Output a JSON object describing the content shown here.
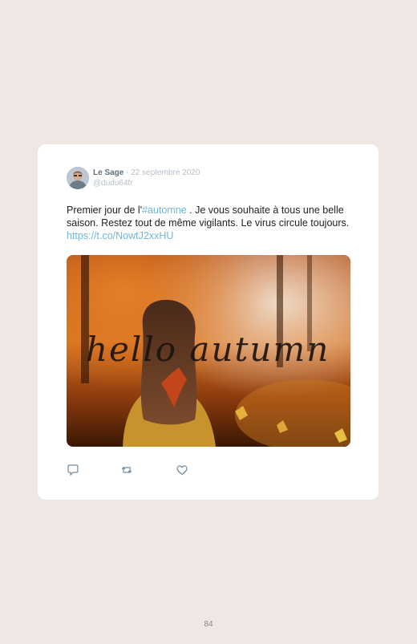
{
  "tweet": {
    "author": "Le Sage",
    "separator": " · ",
    "date": "22 septembre 2020",
    "handle": "@dudu64fr",
    "text_before": "Premier jour de l'",
    "hashtag": "#automne",
    "text_after": " . Je vous souhaite à tous une belle saison. Restez tout de même vigilants. Le virus circule toujours. ",
    "link": "https://t.co/NowtJ2xxHU",
    "image_overlay_text": "hello autumn"
  },
  "actions": {
    "reply_icon": "reply-icon",
    "retweet_icon": "retweet-icon",
    "like_icon": "heart-icon"
  },
  "footer": {
    "page_number": "84"
  },
  "colors": {
    "background": "#efe7e4",
    "card": "#ffffff",
    "link": "#6fb6dc",
    "author": "#5f6f7c",
    "muted": "#b6bfc7"
  }
}
